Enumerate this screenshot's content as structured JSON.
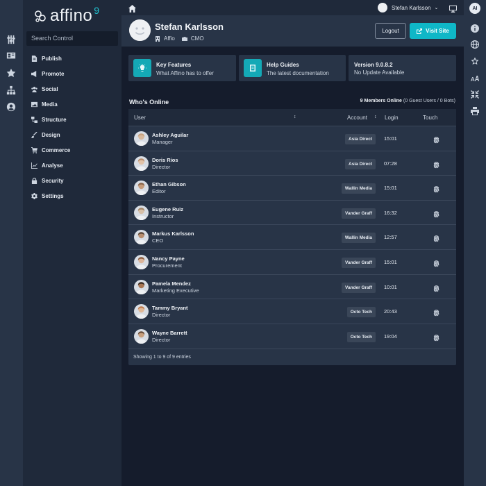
{
  "app": {
    "logo_text": "affino",
    "logo_version": "9"
  },
  "colors": {
    "accent": "#0fb7c7",
    "sidebar_bg": "#1f293a",
    "panel_bg": "#283447",
    "page_bg": "#151c2c"
  },
  "rail_icons": [
    "sliders-icon",
    "id-card-icon",
    "star-icon",
    "sitemap-icon",
    "user-circle-icon"
  ],
  "right_rail_icons": [
    "ai-badge-icon",
    "info-icon",
    "globe-icon",
    "star-outline-icon",
    "text-size-icon",
    "compress-icon",
    "print-icon"
  ],
  "right_rail": {
    "ai_label": "AI"
  },
  "sidebar": {
    "search_placeholder": "Search Control",
    "items": [
      {
        "label": "Publish",
        "icon": "file-icon"
      },
      {
        "label": "Promote",
        "icon": "megaphone-icon"
      },
      {
        "label": "Social",
        "icon": "users-icon"
      },
      {
        "label": "Media",
        "icon": "image-icon"
      },
      {
        "label": "Structure",
        "icon": "structure-icon"
      },
      {
        "label": "Design",
        "icon": "brush-icon"
      },
      {
        "label": "Commerce",
        "icon": "cart-icon"
      },
      {
        "label": "Analyse",
        "icon": "chart-icon"
      },
      {
        "label": "Security",
        "icon": "lock-icon"
      },
      {
        "label": "Settings",
        "icon": "gear-icon"
      }
    ]
  },
  "topbar": {
    "user_name": "Stefan Karlsson"
  },
  "profile": {
    "name": "Stefan Karlsson",
    "org": "Affio",
    "role": "CMO",
    "logout_label": "Logout",
    "visit_label": "Visit Site"
  },
  "cards": [
    {
      "title": "Key Features",
      "subtitle": "What Affino has to offer",
      "icon": "lightbulb-icon"
    },
    {
      "title": "Help Guides",
      "subtitle": "The latest documentation",
      "icon": "book-icon"
    },
    {
      "title": "Version 9.0.8.2",
      "subtitle": "No Update Available"
    }
  ],
  "online": {
    "title": "Who's Online",
    "members_bold": "9 Members Online",
    "members_detail": "(0 Guest Users / 0 Bots)",
    "columns": {
      "user": "User",
      "account": "Account",
      "login": "Login",
      "touch": "Touch"
    },
    "rows": [
      {
        "name": "Ashley Aguilar",
        "role": "Manager",
        "account": "Asia Direct",
        "login": "15:01"
      },
      {
        "name": "Doris Rios",
        "role": "Director",
        "account": "Asia Direct",
        "login": "07:28"
      },
      {
        "name": "Ethan Gibson",
        "role": "Editor",
        "account": "Wallin Media",
        "login": "15:01"
      },
      {
        "name": "Eugene Ruiz",
        "role": "Instructor",
        "account": "Vander Graff",
        "login": "16:32"
      },
      {
        "name": "Markus Karlsson",
        "role": "CEO",
        "account": "Wallin Media",
        "login": "12:57"
      },
      {
        "name": "Nancy Payne",
        "role": "Procurement",
        "account": "Vander Graff",
        "login": "15:01"
      },
      {
        "name": "Pamela Mendez",
        "role": "Marketing Executive",
        "account": "Vander Graff",
        "login": "10:01"
      },
      {
        "name": "Tammy Bryant",
        "role": "Director",
        "account": "Octo Tech",
        "login": "20:43"
      },
      {
        "name": "Wayne Barrett",
        "role": "Director",
        "account": "Octo Tech",
        "login": "19:04"
      }
    ],
    "footer": "Showing 1 to 9 of 9 entries"
  }
}
